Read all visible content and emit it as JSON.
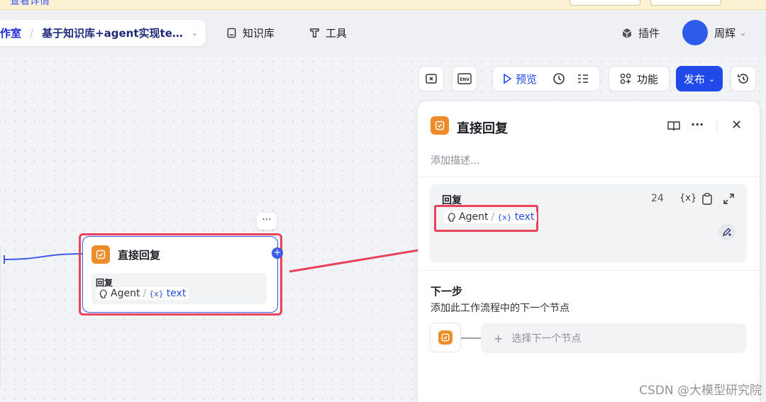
{
  "notice": {
    "link_text": "查看详情"
  },
  "header": {
    "crumb_parent": "作室",
    "crumb_current": "基于知识库+agent实现te…",
    "nav_knowledge": "知识库",
    "nav_tools": "工具",
    "nav_plugins": "插件",
    "username": "周辉"
  },
  "toolbar": {
    "preview": "预览",
    "features": "功能",
    "publish": "发布"
  },
  "node": {
    "title": "直接回复",
    "section_label": "回复",
    "agent": "Agent",
    "var": "text"
  },
  "panel": {
    "title": "直接回复",
    "description_placeholder": "添加描述...",
    "reply_label": "回复",
    "char_count": "24",
    "agent": "Agent",
    "var": "text",
    "next_step_title": "下一步",
    "next_step_desc": "添加此工作流程中的下一个节点",
    "next_node_placeholder": "选择下一个节点"
  },
  "watermark": "CSDN @大模型研究院",
  "colors": {
    "accent": "#2148e8",
    "orange": "#ec8d2a",
    "highlight": "#e8435a"
  }
}
